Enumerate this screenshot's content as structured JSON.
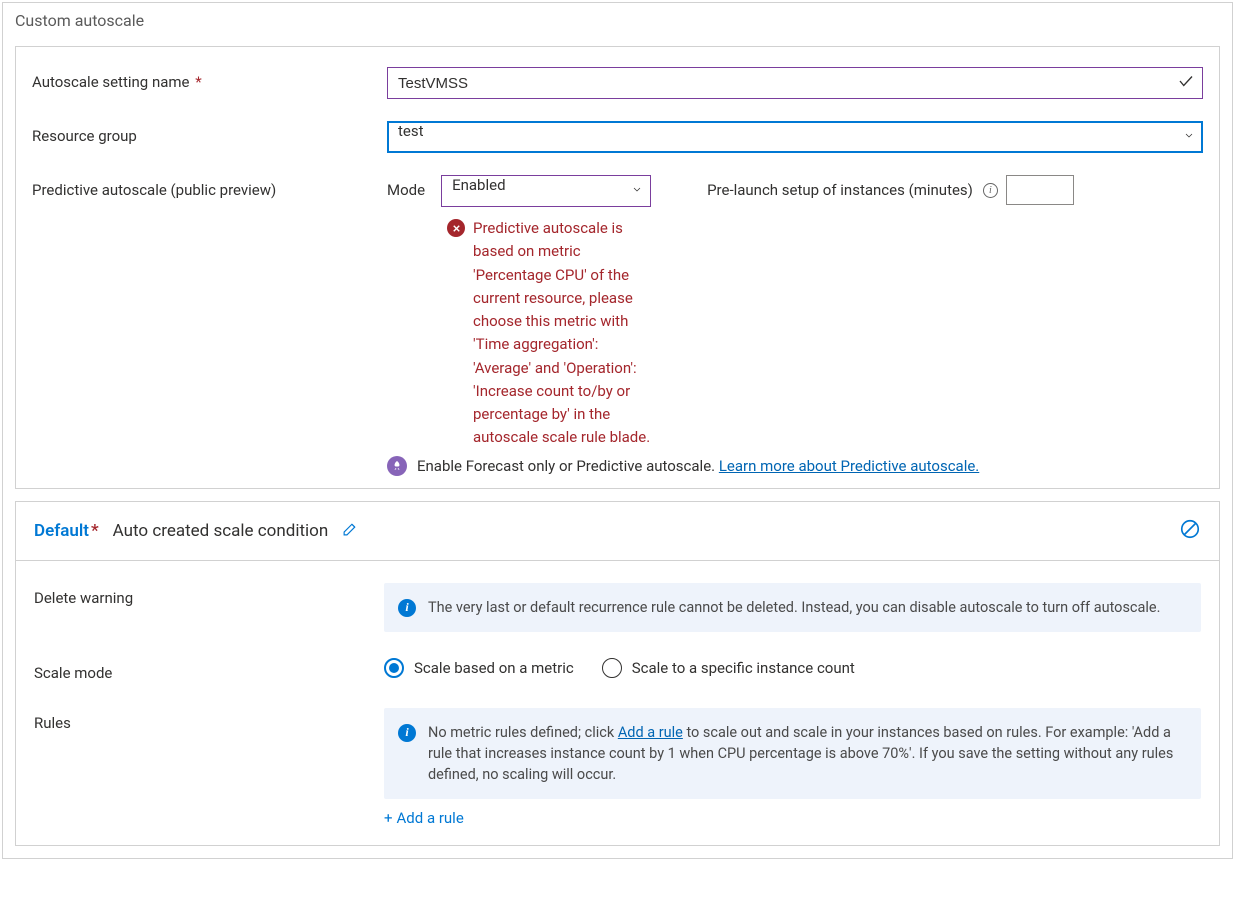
{
  "panel": {
    "title": "Custom autoscale"
  },
  "form": {
    "name_label": "Autoscale setting name",
    "name_value": "TestVMSS",
    "rg_label": "Resource group",
    "rg_value": "test",
    "predictive_label": "Predictive autoscale (public preview)",
    "mode_label": "Mode",
    "mode_value": "Enabled",
    "prelaunch_label": "Pre-launch setup of instances (minutes)",
    "prelaunch_value": "",
    "error_text": "Predictive autoscale is based on metric 'Percentage CPU' of the current resource, please choose this metric with 'Time aggregation': 'Average' and 'Operation': 'Increase count to/by or percentage by' in the autoscale scale rule blade.",
    "forecast_text": "Enable Forecast only or Predictive autoscale. ",
    "forecast_link": "Learn more about Predictive autoscale."
  },
  "condition": {
    "default_label": "Default",
    "name": "Auto created scale condition",
    "delete_warning_label": "Delete warning",
    "delete_warning_text": "The very last or default recurrence rule cannot be deleted. Instead, you can disable autoscale to turn off autoscale.",
    "scale_mode_label": "Scale mode",
    "scale_mode_options": {
      "metric": "Scale based on a metric",
      "count": "Scale to a specific instance count"
    },
    "scale_mode_selected": "metric",
    "rules_label": "Rules",
    "rules_info_pre": "No metric rules defined; click ",
    "rules_info_link": "Add a rule",
    "rules_info_post": " to scale out and scale in your instances based on rules. For example: 'Add a rule that increases instance count by 1 when CPU percentage is above 70%'. If you save the setting without any rules defined, no scaling will occur.",
    "add_rule_label": "Add a rule"
  }
}
